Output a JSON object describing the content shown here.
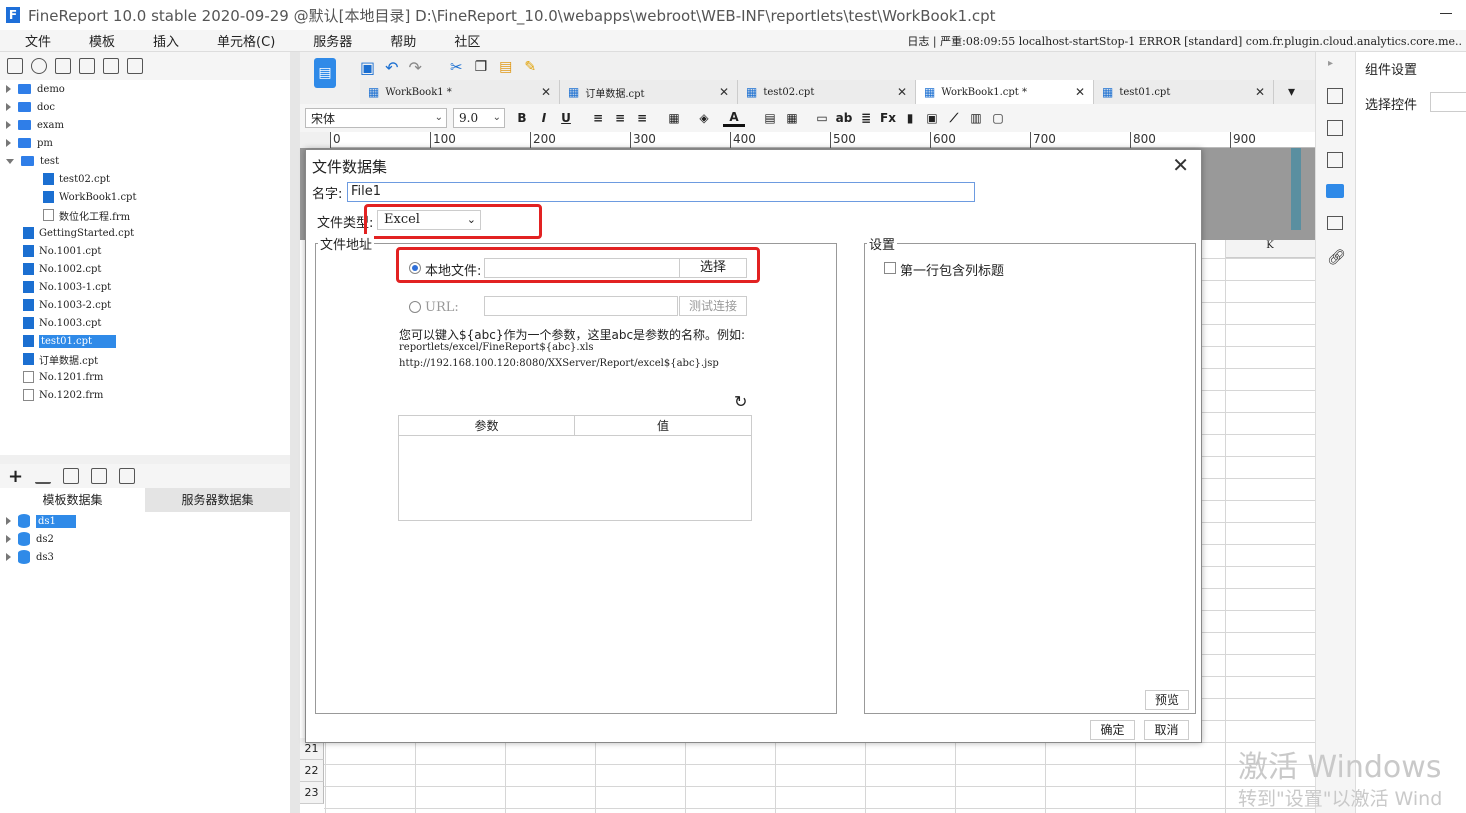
{
  "window": {
    "title": "FineReport 10.0 stable 2020-09-29 @默认[本地目录]     D:\\FineReport_10.0\\webapps\\webroot\\WEB-INF\\reportlets\\test\\WorkBook1.cpt"
  },
  "menu": {
    "items": [
      "文件",
      "模板",
      "插入",
      "单元格(C)",
      "服务器",
      "帮助",
      "社区"
    ],
    "status": "日志  |  严重:08:09:55 localhost-startStop-1 ERROR [standard] com.fr.plugin.cloud.analytics.core.me.."
  },
  "tree": {
    "items": [
      {
        "label": "demo",
        "type": "folder",
        "level": 0,
        "expanded": false
      },
      {
        "label": "doc",
        "type": "folder",
        "level": 0,
        "expanded": false
      },
      {
        "label": "exam",
        "type": "folder",
        "level": 0,
        "expanded": false
      },
      {
        "label": "pm",
        "type": "folder",
        "level": 0,
        "expanded": false
      },
      {
        "label": "test",
        "type": "folder",
        "level": 0,
        "expanded": true
      },
      {
        "label": "test02.cpt",
        "type": "cpt",
        "level": 2
      },
      {
        "label": "WorkBook1.cpt",
        "type": "cpt",
        "level": 2
      },
      {
        "label": "数位化工程.frm",
        "type": "frm",
        "level": 2
      },
      {
        "label": "GettingStarted.cpt",
        "type": "cpt",
        "level": 1
      },
      {
        "label": "No.1001.cpt",
        "type": "cpt",
        "level": 1
      },
      {
        "label": "No.1002.cpt",
        "type": "cpt",
        "level": 1
      },
      {
        "label": "No.1003-1.cpt",
        "type": "cpt",
        "level": 1
      },
      {
        "label": "No.1003-2.cpt",
        "type": "cpt",
        "level": 1
      },
      {
        "label": "No.1003.cpt",
        "type": "cpt",
        "level": 1
      },
      {
        "label": "test01.cpt",
        "type": "cpt",
        "level": 1,
        "selected": true
      },
      {
        "label": "订单数据.cpt",
        "type": "cpt",
        "level": 1
      },
      {
        "label": "No.1201.frm",
        "type": "frm",
        "level": 1
      },
      {
        "label": "No.1202.frm",
        "type": "frm",
        "level": 1
      }
    ]
  },
  "datasets": {
    "tab_template": "模板数据集",
    "tab_server": "服务器数据集",
    "items": [
      "ds1",
      "ds2",
      "ds3"
    ]
  },
  "doc_tabs": [
    {
      "label": "WorkBook1 *",
      "active": false
    },
    {
      "label": "订单数据.cpt",
      "active": false
    },
    {
      "label": "test02.cpt",
      "active": false
    },
    {
      "label": "WorkBook1.cpt *",
      "active": true
    },
    {
      "label": "test01.cpt",
      "active": false
    }
  ],
  "format_toolbar": {
    "font": "宋体",
    "size": "9.0"
  },
  "ruler": {
    "ticks": [
      "0",
      "100",
      "200",
      "300",
      "400",
      "500",
      "600",
      "700",
      "800",
      "900"
    ]
  },
  "grid": {
    "column_k": "K",
    "rows": [
      "21",
      "22",
      "23"
    ]
  },
  "right_panel": {
    "header": "组件设置",
    "select_label": "选择控件"
  },
  "watermark": {
    "line1": "激活 Windows",
    "line2": "转到\"设置\"以激活 Wind"
  },
  "dialog": {
    "title": "文件数据集",
    "name_label": "名字:",
    "name_value": "File1",
    "file_type_label": "文件类型:",
    "file_type_value": "Excel",
    "address_group": "文件地址",
    "local_label": "本地文件:",
    "choose_button": "选择",
    "url_label": "URL:",
    "test_button": "测试连接",
    "help_line1": "您可以键入${abc}作为一个参数，这里abc是参数的名称。例如:",
    "help_line2": "reportlets/excel/FineReport${abc}.xls",
    "help_line3": "http://192.168.100.120:8080/XXServer/Report/excel${abc}.jsp",
    "param_header": "参数",
    "value_header": "值",
    "settings_group": "设置",
    "first_row_header": "第一行包含列标题",
    "preview_button": "预览",
    "ok_button": "确定",
    "cancel_button": "取消",
    "highlight_color": "#e22222"
  }
}
